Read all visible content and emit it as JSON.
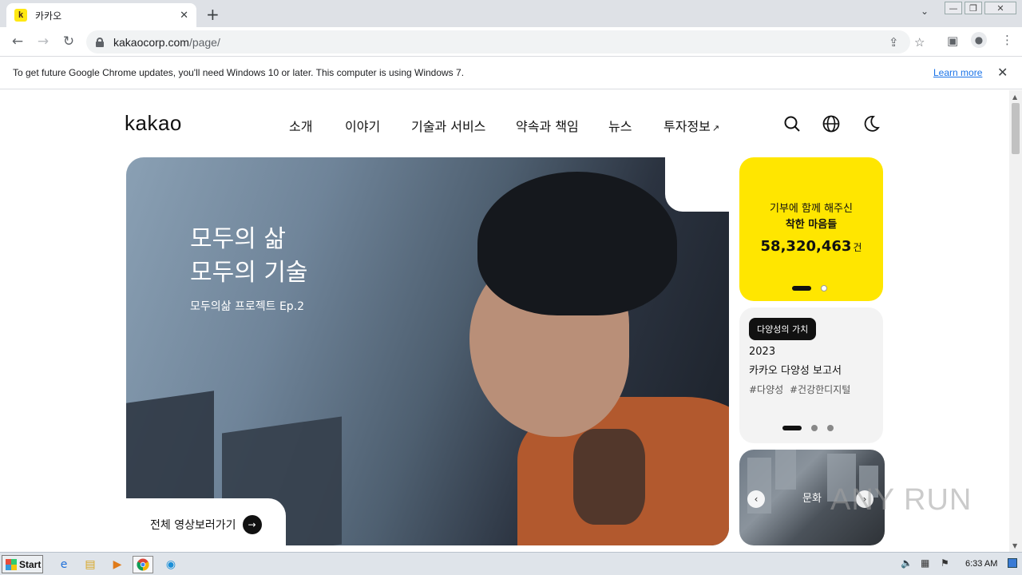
{
  "browser": {
    "tab_title": "카카오",
    "tab_favicon": "k",
    "url_domain": "kakaocorp.com",
    "url_path": "/page/",
    "infobar_text": "To get future Google Chrome updates, you'll need Windows 10 or later. This computer is using Windows 7.",
    "infobar_link": "Learn more"
  },
  "site": {
    "logo": "kakao",
    "nav": [
      "소개",
      "이야기",
      "기술과 서비스",
      "약속과 책임",
      "뉴스",
      "투자정보"
    ],
    "nav_external_arrow": "↗"
  },
  "hero": {
    "title_line1": "모두의 삶",
    "title_line2": "모두의 기술",
    "subtitle": "모두의삶 프로젝트 Ep.2",
    "cta": "전체 영상보러가기"
  },
  "donation_card": {
    "label_line1": "기부에 함께 해주신",
    "label_line2": "착한 마음들",
    "count": "58,320,463",
    "unit": "건",
    "bg_color": "#ffe600"
  },
  "report_card": {
    "badge": "다양성의 가치",
    "year": "2023",
    "title": "카카오 다양성 보고서",
    "tags": "#다양성 #건강한디지털"
  },
  "photo_card": {
    "label": "문화"
  },
  "watermark": "ANY RUN",
  "taskbar": {
    "start": "Start",
    "clock": "6:33 AM"
  }
}
